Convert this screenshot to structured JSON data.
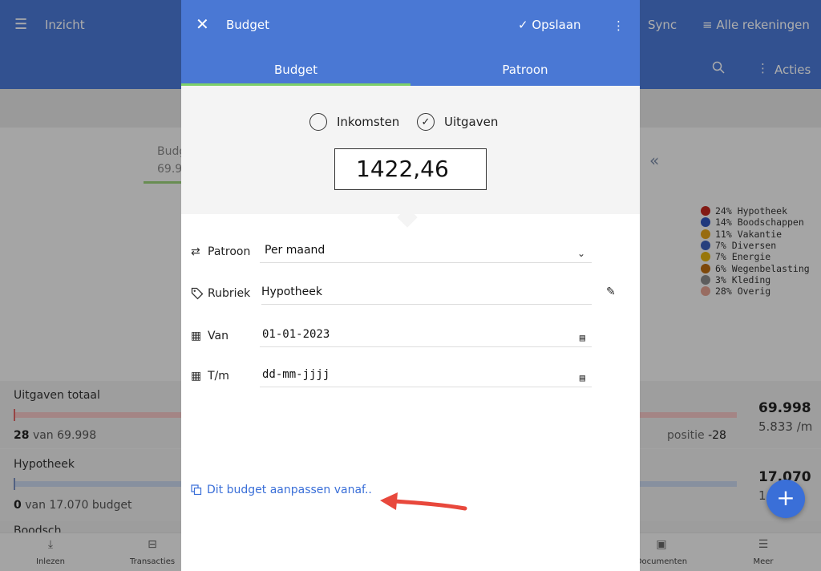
{
  "app": {
    "title": "Inzicht",
    "sync": "Sync",
    "accounts": "Alle rekeningen",
    "actions": "Acties"
  },
  "summary": {
    "budget_label": "Budg",
    "budget_value": "69.9",
    "collapse_glyph": "«"
  },
  "legend": [
    {
      "label": "24% Hypotheek",
      "color": "#c0271e"
    },
    {
      "label": "14% Boodschappen",
      "color": "#2f53b8"
    },
    {
      "label": "11% Vakantie",
      "color": "#e0a018"
    },
    {
      "label": "7% Diversen",
      "color": "#3a5fb8"
    },
    {
      "label": "7% Energie",
      "color": "#e0b010"
    },
    {
      "label": "6% Wegenbelasting",
      "color": "#b86a10"
    },
    {
      "label": "3% Kleding",
      "color": "#8a8a8a"
    },
    {
      "label": "28% Overig",
      "color": "#e0a090"
    }
  ],
  "cards": {
    "expenses": {
      "label": "Uitgaven totaal",
      "count": "28",
      "count_suffix": "van 69.998",
      "position_label": "positie",
      "position_value": "-28",
      "total": "69.998",
      "per_month": "5.833 /m"
    },
    "mortgage": {
      "label": "Hypotheek",
      "count": "0",
      "count_suffix": "van 17.070 budget",
      "total": "17.070",
      "per_month": "1"
    },
    "next": {
      "label": "Boodsch"
    }
  },
  "fab": "+",
  "bottomnav": [
    {
      "label": "Inlezen",
      "icon": "download-icon"
    },
    {
      "label": "Transacties",
      "icon": "transactions-icon"
    },
    {
      "label": "Documenten",
      "icon": "archive-icon"
    },
    {
      "label": "Meer",
      "icon": "menu-icon"
    }
  ],
  "modal": {
    "title": "Budget",
    "save_label": "Opslaan",
    "tabs": [
      "Budget",
      "Patroon"
    ],
    "radio_income": "Inkomsten",
    "radio_expenses": "Uitgaven",
    "amount": "1422,46",
    "fields": {
      "pattern": {
        "label": "Patroon",
        "value": "Per maand"
      },
      "category": {
        "label": "Rubriek",
        "value": "Hypotheek"
      },
      "from": {
        "label": "Van",
        "value": "01-01-2023"
      },
      "to": {
        "label": "T/m",
        "value": "dd-mm-jjjj"
      }
    },
    "adjust_link": "Dit budget aanpassen vanaf.."
  },
  "colors": {
    "primary": "#4a78d4",
    "tab_indicator": "#7ed06a",
    "link": "#3a6fd8",
    "annotation_arrow": "#e8483c"
  }
}
